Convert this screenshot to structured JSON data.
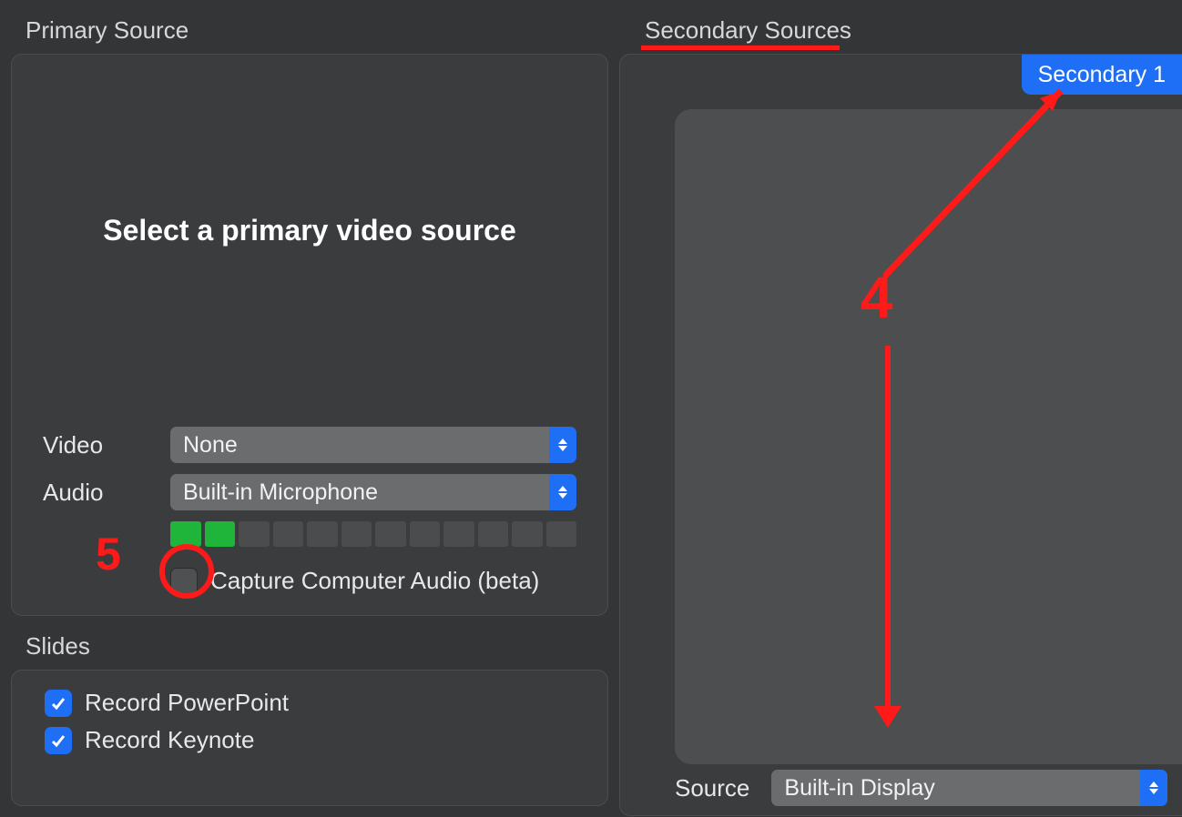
{
  "primary": {
    "title": "Primary Source",
    "placeholder": "Select a primary video source",
    "video_label": "Video",
    "video_value": "None",
    "audio_label": "Audio",
    "audio_value": "Built-in Microphone",
    "meter_segments": 12,
    "meter_active": 2,
    "capture_audio_label": "Capture Computer Audio (beta)",
    "capture_audio_checked": false
  },
  "slides": {
    "title": "Slides",
    "items": [
      {
        "label": "Record PowerPoint",
        "checked": true
      },
      {
        "label": "Record Keynote",
        "checked": true
      }
    ]
  },
  "secondary": {
    "title": "Secondary Sources",
    "tab_label": "Secondary 1",
    "source_label": "Source",
    "source_value": "Built-in Display"
  },
  "annotations": {
    "label4": "4",
    "label5": "5"
  }
}
